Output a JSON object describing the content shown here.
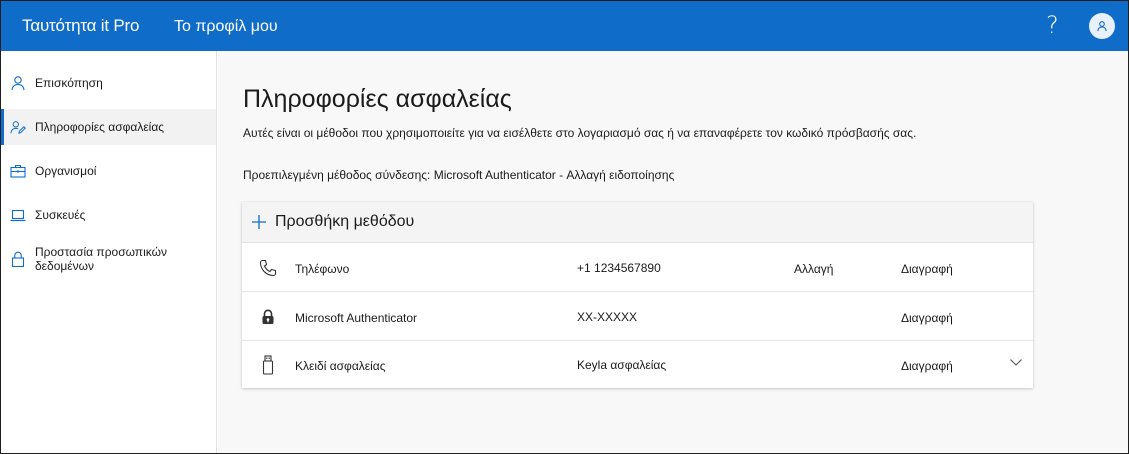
{
  "header": {
    "brand": "Ταυτότητα it Pro",
    "profile_link": "Το προφίλ μου",
    "help_icon": "?",
    "avatar_icon": "person-icon"
  },
  "sidebar": {
    "items": [
      {
        "label": "Επισκόπηση",
        "icon": "person-icon",
        "active": false
      },
      {
        "label": "Πληροφορίες ασφαλείας",
        "icon": "person-edit-icon",
        "active": true
      },
      {
        "label": "Οργανισμοί",
        "icon": "briefcase-icon",
        "active": false
      },
      {
        "label": "Συσκευές",
        "icon": "laptop-icon",
        "active": false
      },
      {
        "label": "Προστασία προσωπικών δεδομένων",
        "icon": "lock-icon",
        "active": false
      }
    ]
  },
  "main": {
    "title": "Πληροφορίες ασφαλείας",
    "description": "Αυτές είναι οι μέθοδοι που χρησιμοποιείτε για να εισέλθετε στο λογαριασμό σας ή να επαναφέρετε τον κωδικό πρόσβασής σας.",
    "default_method": "Προεπιλεγμένη μέθοδος σύνδεσης: Microsoft Authenticator - Αλλαγή ειδοποίησης",
    "add_method": "Προσθήκη μεθόδου",
    "methods": [
      {
        "name": "Τηλέφωνο",
        "value": "+1 1234567890",
        "change": "Αλλαγή",
        "delete": "Διαγραφή",
        "icon": "phone-icon"
      },
      {
        "name": "Microsoft Authenticator",
        "value": "XX-XXXXX",
        "change": "",
        "delete": "Διαγραφή",
        "icon": "authenticator-lock-icon"
      },
      {
        "name": "Κλειδί ασφαλείας",
        "value": "Keyla ασφαλείας",
        "change": "",
        "delete": "Διαγραφή",
        "icon": "usb-key-icon"
      }
    ]
  },
  "colors": {
    "topbar": "#0f6cc8",
    "accent": "#0f6cc8",
    "sidebar_active_bg": "#f2f2f2",
    "main_bg": "#f8f8f8"
  }
}
